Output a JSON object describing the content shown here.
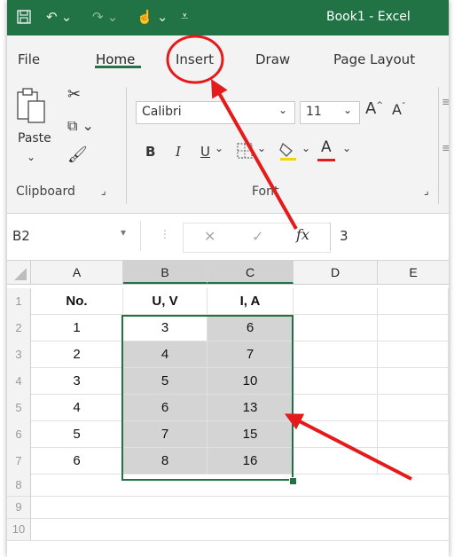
{
  "window": {
    "title": "Book1  -  Excel"
  },
  "tabs": [
    {
      "label": "File"
    },
    {
      "label": "Home"
    },
    {
      "label": "Insert"
    },
    {
      "label": "Draw"
    },
    {
      "label": "Page Layout"
    }
  ],
  "ribbon": {
    "paste_label": "Paste",
    "font_name": "Calibri",
    "font_size": "11",
    "bold": "B",
    "italic": "I",
    "underline": "U",
    "groups": {
      "clipboard": "Clipboard",
      "font": "Font"
    }
  },
  "formula_bar": {
    "name_box": "B2",
    "fx": "fx",
    "value": "3"
  },
  "grid": {
    "columns": [
      "A",
      "B",
      "C",
      "D",
      "E"
    ],
    "row_numbers": [
      "1",
      "2",
      "3",
      "4",
      "5",
      "6",
      "7",
      "8",
      "9",
      "10"
    ],
    "rows": [
      [
        "No.",
        "U, V",
        "I, A"
      ],
      [
        "1",
        "3",
        "6"
      ],
      [
        "2",
        "4",
        "7"
      ],
      [
        "3",
        "5",
        "10"
      ],
      [
        "4",
        "6",
        "13"
      ],
      [
        "5",
        "7",
        "15"
      ],
      [
        "6",
        "8",
        "16"
      ]
    ]
  },
  "colors": {
    "accent": "#217346",
    "annotation": "#e51b1b",
    "selection": "#d4d4d4"
  }
}
